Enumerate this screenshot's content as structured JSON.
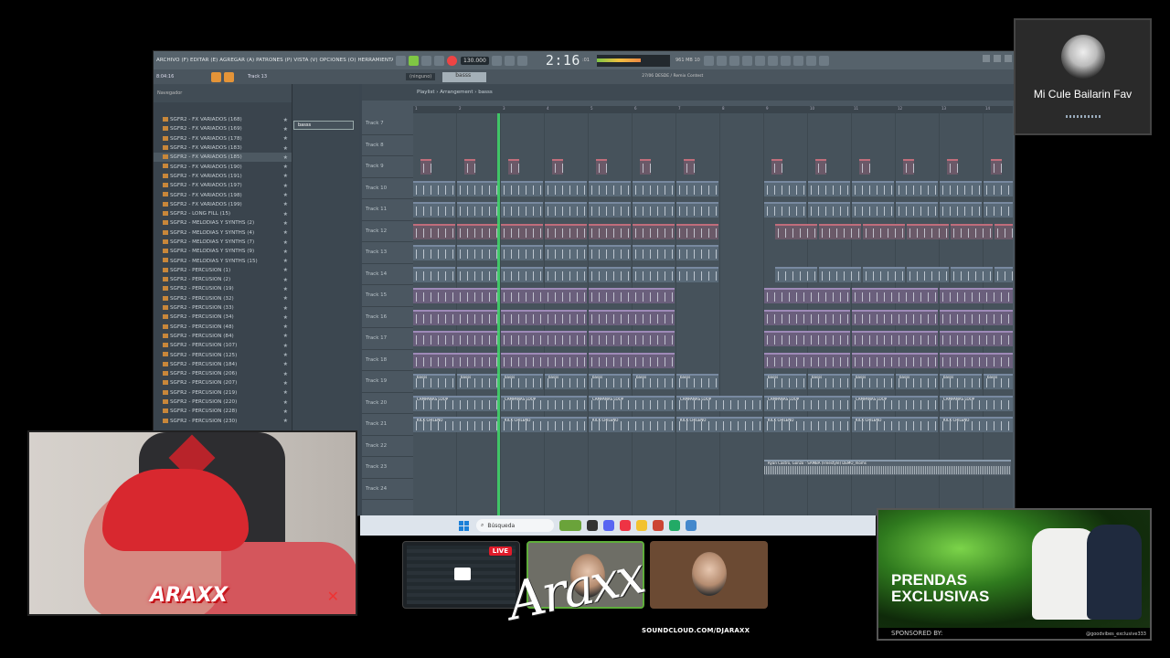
{
  "daw": {
    "menu": "ARCHIVO (F) EDITAR (E) AGREGAR (A) PATRONES (P) VISTA (V) OPCIONES (O) HERRAMIENTAS (T) AYUDA",
    "bpm": "130.000",
    "time": "2:16",
    "time_sub": ":01",
    "cpu": "961 MB\n10",
    "time_small": "8:04:16",
    "track_small": "Track 13",
    "pattern_select": "(ninguno)",
    "search_value": "basss",
    "song_title": "27/06 DESDE / Remix\nContest",
    "breadcrumb": "Playlist › Arrangement › basss",
    "channel_pill": "basss",
    "browser_label": "Navegador",
    "browser_items": [
      "SGFR2 - FX VARIADOS (168)",
      "SGFR2 - FX VARIADOS (169)",
      "SGFR2 - FX VARIADOS (178)",
      "SGFR2 - FX VARIADOS (183)",
      "SGFR2 - FX VARIADOS (185)",
      "SGFR2 - FX VARIADOS (190)",
      "SGFR2 - FX VARIADOS (191)",
      "SGFR2 - FX VARIADOS (197)",
      "SGFR2 - FX VARIADOS (198)",
      "SGFR2 - FX VARIADOS (199)",
      "SGFR2 - LONG FILL (15)",
      "SGFR2 - MELODIAS Y SYNTHS (2)",
      "SGFR2 - MELODIAS Y SYNTHS (4)",
      "SGFR2 - MELODIAS Y SYNTHS (7)",
      "SGFR2 - MELODIAS Y SYNTHS (9)",
      "SGFR2 - MELODIAS Y SYNTHS (15)",
      "SGFR2 - PERCUSION (1)",
      "SGFR2 - PERCUSION (2)",
      "SGFR2 - PERCUSION (19)",
      "SGFR2 - PERCUSION (32)",
      "SGFR2 - PERCUSION (33)",
      "SGFR2 - PERCUSION (34)",
      "SGFR2 - PERCUSION (48)",
      "SGFR2 - PERCUSION (84)",
      "SGFR2 - PERCUSION (107)",
      "SGFR2 - PERCUSION (125)",
      "SGFR2 - PERCUSION (184)",
      "SGFR2 - PERCUSION (206)",
      "SGFR2 - PERCUSION (207)",
      "SGFR2 - PERCUSION (219)",
      "SGFR2 - PERCUSION (220)",
      "SGFR2 - PERCUSION (228)",
      "SGFR2 - PERCUSION (230)"
    ],
    "ruler_ticks": [
      "1",
      "2",
      "3",
      "4",
      "5",
      "6",
      "7",
      "8",
      "9",
      "10",
      "11",
      "12",
      "13",
      "14"
    ],
    "tracks": [
      "Track 7",
      "Track 8",
      "Track 9",
      "Track 10",
      "Track 11",
      "Track 12",
      "Track 13",
      "Track 14",
      "Track 15",
      "Track 16",
      "Track 17",
      "Track 18",
      "Track 19",
      "Track 20",
      "Track 21",
      "Track 22",
      "Track 23",
      "Track 24"
    ],
    "clip_labels": {
      "basss": "basss",
      "campanas": "CAMPANAS LOOP",
      "kick": "KICK CHILENO",
      "audio": "Ryan Castro, Gonzo - SAMBA (Freestyle) DEMO_moms"
    }
  },
  "taskbar": {
    "search_placeholder": "Búsqueda"
  },
  "now_playing": {
    "title": "Mi Cule Bailarin Fav"
  },
  "stream": {
    "live_badge": "LIVE",
    "signature": "Araxx",
    "soundcloud": "SOUNDCLOUD.COM/DJARAXX",
    "webcam_badge": "ARAXX"
  },
  "ad": {
    "headline_1": "PRENDAS",
    "headline_2": "EXCLUSIVAS",
    "sponsored": "SPONSORED BY:",
    "handle": "@goodvibes_exclusive333"
  },
  "colors": {
    "playhead": "#3fd96a",
    "accent_orange": "#e49438",
    "live_red": "#e01b2a"
  }
}
